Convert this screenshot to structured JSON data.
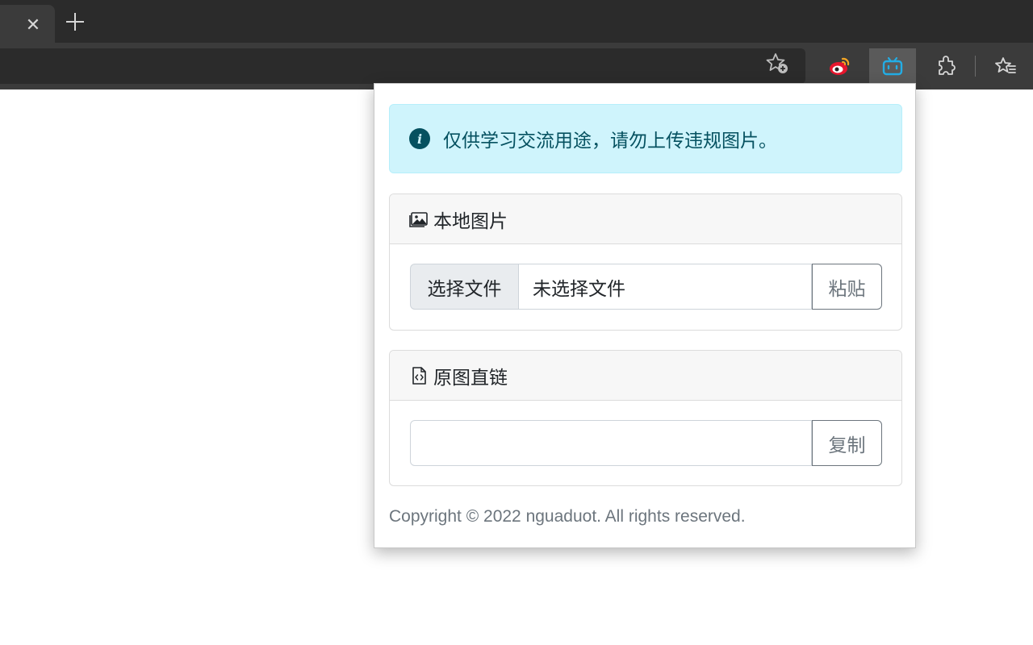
{
  "browser": {
    "tab_close_icon": "close-icon",
    "new_tab_icon": "plus-icon",
    "toolbar_icons": [
      "favorite-add-icon",
      "weibo-icon",
      "bilibili-icon",
      "extensions-icon",
      "favorites-icon"
    ]
  },
  "popup": {
    "alert": {
      "text": "仅供学习交流用途，请勿上传违规图片。",
      "color": "#055160",
      "background": "#cff4fc"
    },
    "local_image": {
      "title": "本地图片",
      "choose_file_label": "选择文件",
      "file_name": "未选择文件",
      "paste_label": "粘贴"
    },
    "direct_link": {
      "title": "原图直链",
      "value": "",
      "copy_label": "复制"
    },
    "footer": "Copyright © 2022 nguaduot. All rights reserved."
  }
}
